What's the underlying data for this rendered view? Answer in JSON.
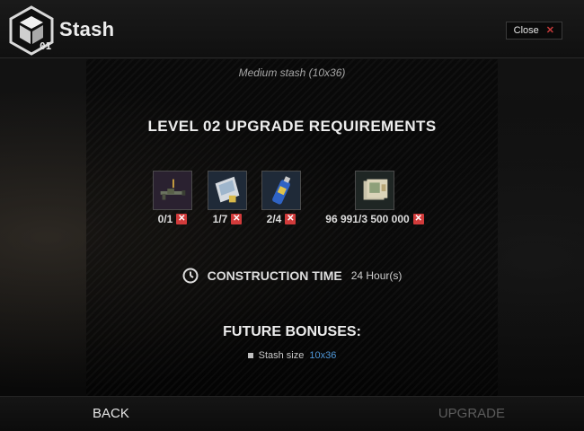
{
  "header": {
    "title": "Stash",
    "level_badge": "01",
    "close_label": "Close",
    "close_mark": "✕"
  },
  "subtitle": "Medium stash (10x36)",
  "requirements": {
    "heading": "LEVEL 02 UPGRADE REQUIREMENTS",
    "items": [
      {
        "icon": "grenade-launcher-icon",
        "count": "0/1",
        "status": "✕"
      },
      {
        "icon": "paper-packet-icon",
        "count": "1/7",
        "status": "✕"
      },
      {
        "icon": "spray-can-icon",
        "count": "2/4",
        "status": "✕"
      },
      {
        "icon": "roubles-icon",
        "count": "96 991/3 500 000",
        "status": "✕"
      }
    ]
  },
  "construction": {
    "label": "CONSTRUCTION TIME",
    "value": "24 Hour(s)"
  },
  "bonuses": {
    "heading": "FUTURE BONUSES:",
    "items": [
      {
        "label": "Stash size",
        "value": "10x36"
      }
    ]
  },
  "footer": {
    "back_label": "BACK",
    "upgrade_label": "UPGRADE"
  },
  "colors": {
    "missing_red": "#d23b3b",
    "bonus_blue": "#4f97d8",
    "disabled_gray": "#5b5b5b"
  }
}
